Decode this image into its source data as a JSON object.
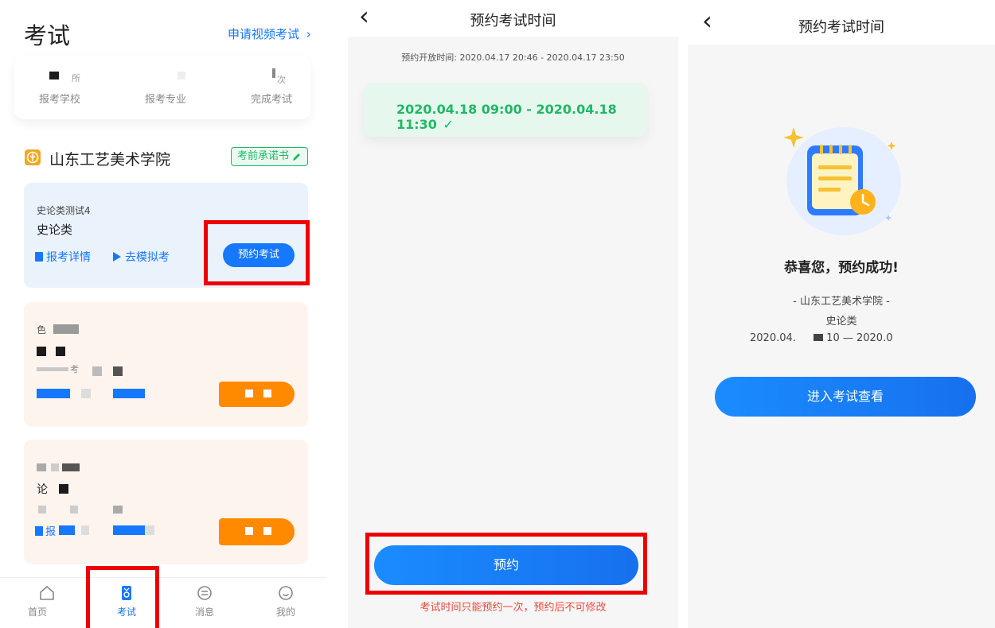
{
  "p1": {
    "title": "考试",
    "apply_video": "申请视频考试",
    "apply_chevron": "›",
    "stats": {
      "school_val": "所",
      "school_label": "报考学校",
      "major_label": "报考专业",
      "done_val": "次",
      "done_label": "完成考试"
    },
    "school_name": "山东工艺美术学院",
    "pledge": "考前承诺书",
    "card1": {
      "subtitle": "史论类测试4",
      "title": "史论类",
      "detail_link": "报考详情",
      "mock_link": "去模拟考",
      "reserve_btn": "预约考试"
    },
    "card2": {
      "line1": "色",
      "line3": "考"
    },
    "card3": {
      "line2": "论",
      "link1": "报"
    },
    "nav": [
      {
        "label": "首页"
      },
      {
        "label": "考试"
      },
      {
        "label": "消息"
      },
      {
        "label": "我的"
      }
    ]
  },
  "p2": {
    "back": "‹",
    "title": "预约考试时间",
    "open_time_label": "预约开放时间:",
    "open_time_value": "2020.04.17 20:46 - 2020.04.17 23:50",
    "slot": "2020.04.18 09:00 - 2020.04.18 11:30",
    "slot_check": "✓",
    "reserve_btn": "预约",
    "warning": "考试时间只能预约一次，预约后不可修改"
  },
  "p3": {
    "back": "‹",
    "title": "预约考试时间",
    "success": "恭喜您，预约成功!",
    "school": "- 山东工艺美术学院 -",
    "subject": "史论类",
    "time_a": "2020.04.",
    "time_b": "10 — 2020.0",
    "enter_btn": "进入考试查看"
  },
  "colors": {
    "accent": "#1677ff",
    "green": "#1fb865",
    "red": "#ee0000",
    "warning": "#e84b3c"
  }
}
